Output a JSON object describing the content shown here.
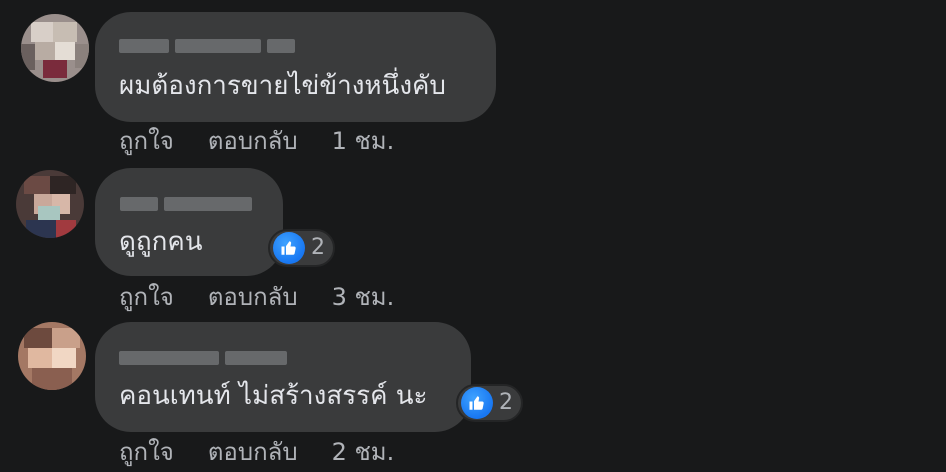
{
  "theme": {
    "background": "#18191a",
    "bubble": "#3a3b3c",
    "text_primary": "#e4e6eb",
    "text_secondary": "#b0b3b8",
    "like_blue": "#1877f2"
  },
  "comments": [
    {
      "author": "",
      "author_blurred": true,
      "text": "ผมต้องการขายไข่ข้างหนึ่งคับ",
      "like_label": "ถูกใจ",
      "reply_label": "ตอบกลับ",
      "time": "1 ชม.",
      "reaction_icon": "like-icon",
      "reaction_count": ""
    },
    {
      "author": "",
      "author_blurred": true,
      "text": "ดูถูกคน",
      "like_label": "ถูกใจ",
      "reply_label": "ตอบกลับ",
      "time": "3 ชม.",
      "reaction_icon": "like-icon",
      "reaction_count": "2"
    },
    {
      "author": "",
      "author_blurred": true,
      "text": "คอนเทนท์ ไม่สร้างสรรค์ นะ",
      "like_label": "ถูกใจ",
      "reply_label": "ตอบกลับ",
      "time": "2 ชม.",
      "reaction_icon": "like-icon",
      "reaction_count": "2"
    }
  ]
}
